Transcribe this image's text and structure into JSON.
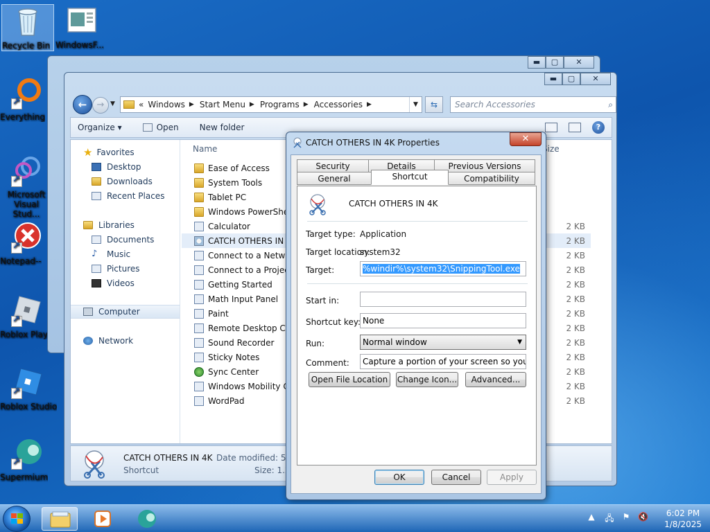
{
  "desktop": {
    "icons": [
      {
        "label": "Recycle Bin"
      },
      {
        "label": "WindowsF..."
      },
      {
        "label": "Everything"
      },
      {
        "label": "Microsoft Visual Stud..."
      },
      {
        "label": "Notepad--"
      },
      {
        "label": "Roblox Player"
      },
      {
        "label": "Roblox Studio"
      },
      {
        "label": "Supermium"
      }
    ]
  },
  "explorer": {
    "address": {
      "prefix": "«",
      "crumbs": [
        "Windows",
        "Start Menu",
        "Programs",
        "Accessories"
      ]
    },
    "search_placeholder": "Search Accessories",
    "toolbar": {
      "organize": "Organize ▾",
      "open": "Open",
      "new_folder": "New folder"
    },
    "nav": {
      "favorites": "Favorites",
      "desktop": "Desktop",
      "downloads": "Downloads",
      "recent_places": "Recent Places",
      "libraries": "Libraries",
      "documents": "Documents",
      "music": "Music",
      "pictures": "Pictures",
      "videos": "Videos",
      "computer": "Computer",
      "network": "Network"
    },
    "columns": {
      "name": "Name",
      "size": "Size"
    },
    "files": [
      {
        "name": "Ease of Access",
        "size": ""
      },
      {
        "name": "System Tools",
        "size": ""
      },
      {
        "name": "Tablet PC",
        "size": ""
      },
      {
        "name": "Windows PowerShell",
        "size": ""
      },
      {
        "name": "Calculator",
        "size": "2 KB"
      },
      {
        "name": "CATCH OTHERS IN 4K",
        "size": "2 KB"
      },
      {
        "name": "Connect to a Network Projector",
        "size": "2 KB"
      },
      {
        "name": "Connect to a Projector",
        "size": "2 KB"
      },
      {
        "name": "Getting Started",
        "size": "2 KB"
      },
      {
        "name": "Math Input Panel",
        "size": "2 KB"
      },
      {
        "name": "Paint",
        "size": "2 KB"
      },
      {
        "name": "Remote Desktop Connection",
        "size": "2 KB"
      },
      {
        "name": "Sound Recorder",
        "size": "2 KB"
      },
      {
        "name": "Sticky Notes",
        "size": "2 KB"
      },
      {
        "name": "Sync Center",
        "size": "2 KB"
      },
      {
        "name": "Windows Mobility Center",
        "size": "2 KB"
      },
      {
        "name": "WordPad",
        "size": "2 KB"
      }
    ],
    "details": {
      "name": "CATCH OTHERS IN 4K",
      "type": "Shortcut",
      "date_label": "Date modified: 5/1",
      "size_label": "Size: 1.2"
    }
  },
  "dialog": {
    "title": "CATCH OTHERS IN 4K Properties",
    "tabs_top": [
      "Security",
      "Details",
      "Previous Versions"
    ],
    "tabs_bottom": [
      "General",
      "Shortcut",
      "Compatibility"
    ],
    "name": "CATCH OTHERS IN 4K",
    "target_type_label": "Target type:",
    "target_type": "Application",
    "target_location_label": "Target location:",
    "target_location": "system32",
    "target_label": "Target:",
    "target_value": "%windir%\\system32\\SnippingTool.exe",
    "start_in_label": "Start in:",
    "start_in_value": "",
    "shortcut_key_label": "Shortcut key:",
    "shortcut_key_value": "None",
    "run_label": "Run:",
    "run_value": "Normal window",
    "comment_label": "Comment:",
    "comment_value": "Capture a portion of your screen so you can save,",
    "open_file_location": "Open File Location",
    "change_icon": "Change Icon...",
    "advanced": "Advanced...",
    "ok": "OK",
    "cancel": "Cancel",
    "apply": "Apply"
  },
  "taskbar": {
    "time": "6:02 PM",
    "date": "1/8/2025"
  }
}
